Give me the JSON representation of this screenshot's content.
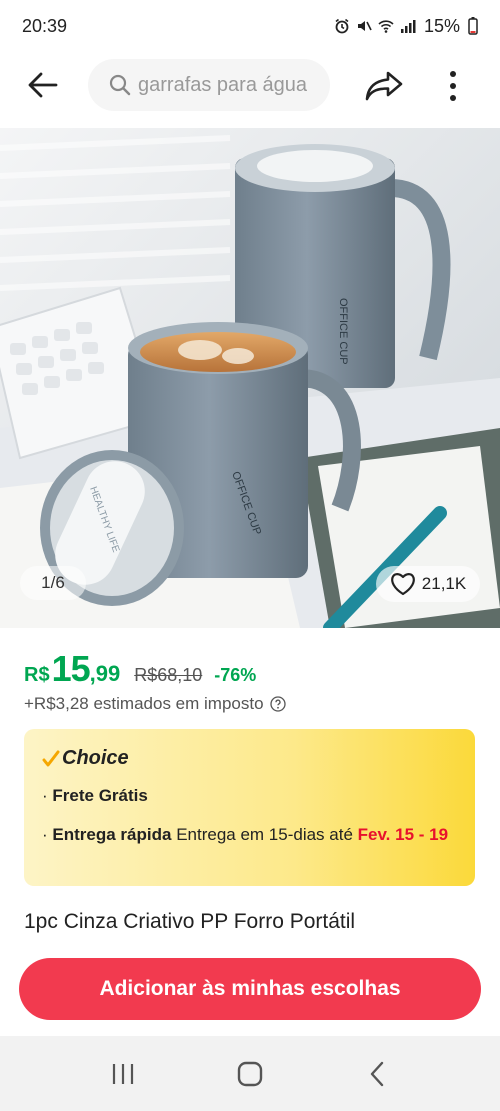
{
  "status_bar": {
    "time": "20:39",
    "battery": "15%",
    "icons": [
      "alarm-icon",
      "mute-icon",
      "wifi-icon",
      "signal-icon",
      "battery-icon"
    ]
  },
  "header": {
    "search_placeholder": "garrafas para água",
    "icons": [
      "back-arrow-icon",
      "search-icon",
      "share-icon",
      "more-icon"
    ]
  },
  "gallery": {
    "counter": "1/6",
    "wishlist_count": "21,1K",
    "mug_label_text": "OFFICE CUP",
    "lid_label_text": "HEALTHY LIFE"
  },
  "price": {
    "currency": "R$",
    "integer": "15",
    "decimal": ",99",
    "original": "R$68,10",
    "discount": "-76%",
    "tax_note": "+R$3,28 estimados em imposto"
  },
  "choice": {
    "title": "Choice",
    "free_shipping": "Frete Grátis",
    "fast_delivery_label": "Entrega rápida",
    "fast_delivery_text": "Entrega em 15-dias até",
    "delivery_date": "Fev. 15 - 19",
    "bullet": "·"
  },
  "product": {
    "title": "1pc Cinza Criativo PP Forro Portátil"
  },
  "cta": {
    "add_label": "Adicionar às minhas escolhas"
  },
  "colors": {
    "price_green": "#00a651",
    "cta_red": "#f23a4f",
    "delivery_red": "#e8112d",
    "choice_gold": "#fbd93a"
  }
}
